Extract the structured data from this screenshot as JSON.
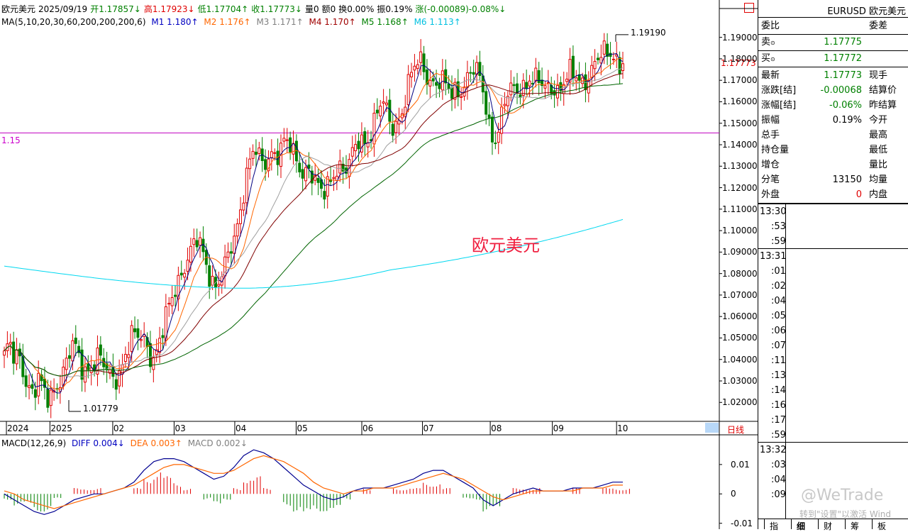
{
  "header": {
    "name": "欧元美元",
    "date": "2025/09/19",
    "open": "开1.17857↓",
    "high": "高1.17923↓",
    "low": "低1.17704↑",
    "close": "收1.17773↓",
    "volume": "量0",
    "amount": "额0",
    "turnover": "换0.00%",
    "amplitude": "振0.19%",
    "change": "涨(-0.00089)-0.08%↓"
  },
  "ma_legend": {
    "params": "MA(5,10,20,30,60,200,200,200,6)",
    "m1": "M1 1.180↑",
    "m2": "M2 1.176↑",
    "m3": "M3 1.171↑",
    "m4": "M4 1.170↑",
    "m5": "M5 1.168↑",
    "m6": "M6 1.113↑"
  },
  "macd_legend": {
    "params": "MACD(12,26,9)",
    "diff": "DIFF 0.004↓",
    "dea": "DEA 0.003↑",
    "macd": "MACD 0.002↓"
  },
  "chart_data": {
    "type": "candlestick",
    "y_ticks": [
      "1.19000",
      "1.18000",
      "1.17000",
      "1.16000",
      "1.15000",
      "1.14000",
      "1.13000",
      "1.12000",
      "1.11000",
      "1.10000",
      "1.09000",
      "1.08000",
      "1.07000",
      "1.06000",
      "1.05000",
      "1.04000",
      "1.03000",
      "1.02000"
    ],
    "x_ticks": [
      "2024",
      "2025",
      "02",
      "03",
      "04",
      "05",
      "06",
      "07",
      "08",
      "09",
      "10"
    ],
    "x_tick_pos": [
      0.005,
      0.066,
      0.154,
      0.24,
      0.325,
      0.411,
      0.503,
      0.588,
      0.683,
      0.77,
      0.86
    ],
    "ylim": [
      1.0125,
      1.1955
    ],
    "close_path": [
      1.042,
      1.045,
      1.038,
      1.041,
      1.035,
      1.03,
      1.025,
      1.03,
      1.022,
      1.02,
      1.026,
      1.032,
      1.036,
      1.04,
      1.045,
      1.04,
      1.035,
      1.038,
      1.04,
      1.042,
      1.036,
      1.032,
      1.03,
      1.034,
      1.04,
      1.045,
      1.05,
      1.047,
      1.05,
      1.048,
      1.043,
      1.045,
      1.05,
      1.058,
      1.065,
      1.075,
      1.082,
      1.088,
      1.09,
      1.094,
      1.09,
      1.085,
      1.08,
      1.077,
      1.079,
      1.082,
      1.088,
      1.095,
      1.11,
      1.125,
      1.135,
      1.138,
      1.13,
      1.128,
      1.135,
      1.14,
      1.138,
      1.142,
      1.138,
      1.132,
      1.13,
      1.128,
      1.133,
      1.125,
      1.118,
      1.114,
      1.12,
      1.128,
      1.133,
      1.13,
      1.128,
      1.133,
      1.14,
      1.142,
      1.145,
      1.15,
      1.155,
      1.158,
      1.152,
      1.148,
      1.152,
      1.158,
      1.165,
      1.172,
      1.175,
      1.178,
      1.174,
      1.172,
      1.17,
      1.168,
      1.165,
      1.162,
      1.166,
      1.168,
      1.171,
      1.174,
      1.172,
      1.168,
      1.16,
      1.148,
      1.145,
      1.15,
      1.158,
      1.163,
      1.165,
      1.168,
      1.17,
      1.172,
      1.168,
      1.167,
      1.165,
      1.168,
      1.17,
      1.166,
      1.168,
      1.171,
      1.17,
      1.172,
      1.17,
      1.175,
      1.176,
      1.178,
      1.18,
      1.182,
      1.185,
      1.18,
      1.1777
    ],
    "high_label": "1.19190",
    "low_label": "1.01779",
    "high_value": 1.1919,
    "low_value": 1.01779,
    "last_price_label": "1.17773",
    "last_price": 1.17773,
    "hline_label": "1.15",
    "hline_value": 1.1455,
    "watermark": "欧元美元",
    "period_label": "日线",
    "macd_ticks": [
      "0.01",
      "0",
      "-0.01"
    ],
    "macd_ylim": [
      -0.012,
      0.016
    ],
    "diff_values": [
      0.0,
      -0.002,
      -0.004,
      -0.006,
      -0.007,
      -0.006,
      -0.004,
      -0.002,
      -0.001,
      0.0,
      0.0,
      0.001,
      0.002,
      0.004,
      0.008,
      0.011,
      0.012,
      0.012,
      0.011,
      0.009,
      0.007,
      0.005,
      0.006,
      0.009,
      0.013,
      0.015,
      0.014,
      0.012,
      0.009,
      0.006,
      0.003,
      0.001,
      -0.001,
      -0.002,
      -0.001,
      0.001,
      0.002,
      0.002,
      0.002,
      0.003,
      0.004,
      0.005,
      0.007,
      0.008,
      0.008,
      0.006,
      0.004,
      0.002,
      -0.002,
      -0.004,
      -0.002,
      0.0,
      0.001,
      0.002,
      0.001,
      0.001,
      0.001,
      0.002,
      0.002,
      0.002,
      0.003,
      0.004,
      0.004
    ],
    "dea_values": [
      0.001,
      0.0,
      -0.002,
      -0.003,
      -0.004,
      -0.005,
      -0.004,
      -0.003,
      -0.002,
      -0.001,
      0.0,
      0.001,
      0.002,
      0.003,
      0.005,
      0.007,
      0.009,
      0.01,
      0.01,
      0.009,
      0.008,
      0.007,
      0.007,
      0.008,
      0.01,
      0.012,
      0.013,
      0.012,
      0.011,
      0.009,
      0.007,
      0.004,
      0.002,
      0.001,
      0.0,
      0.001,
      0.001,
      0.002,
      0.002,
      0.002,
      0.003,
      0.004,
      0.005,
      0.006,
      0.007,
      0.006,
      0.005,
      0.003,
      0.001,
      -0.001,
      -0.002,
      -0.001,
      0.0,
      0.001,
      0.001,
      0.001,
      0.001,
      0.001,
      0.002,
      0.002,
      0.002,
      0.003,
      0.003
    ]
  },
  "quote": {
    "title": "EURUSD 欧元美元",
    "wei_bi": "委比",
    "wei_cha": "委差",
    "sell_label": "卖",
    "sell_value": "1.17775",
    "buy_label": "买",
    "buy_value": "1.17772",
    "rows": [
      {
        "l": "最新",
        "v": "1.17773",
        "r": "现手",
        "color": "#008000"
      },
      {
        "l": "涨跌[结]",
        "v": "-0.00068",
        "r": "结算价",
        "color": "#008000"
      },
      {
        "l": "涨幅[结]",
        "v": "-0.06%",
        "r": "昨结算",
        "color": "#008000"
      },
      {
        "l": "振幅",
        "v": "0.19%",
        "r": "今开",
        "color": "#000000"
      },
      {
        "l": "总手",
        "v": "",
        "r": "最高",
        "color": "#000000"
      },
      {
        "l": "持仓量",
        "v": "",
        "r": "最低",
        "color": "#000000"
      },
      {
        "l": "增仓",
        "v": "",
        "r": "量比",
        "color": "#000000"
      },
      {
        "l": "分笔",
        "v": "13150",
        "r": "均量",
        "color": "#000000"
      },
      {
        "l": "外盘",
        "v": "0",
        "r": "内盘",
        "color": "#e00000"
      }
    ],
    "times": [
      "13:30",
      ":53",
      ":59",
      "13:31",
      ":01",
      ":02",
      ":04",
      ":05",
      ":06",
      ":07",
      ":11",
      ":13",
      ":14",
      ":16",
      ":17",
      ":59",
      "13:32",
      ":03",
      ":04",
      ":09"
    ],
    "tabs": [
      "指",
      "细",
      "财",
      "筹",
      "板"
    ],
    "watermark_text": "@WeTrade",
    "activate_text": "转到\"设置\"以激活 Wind"
  },
  "colors": {
    "up": "#e00000",
    "down": "#008000",
    "ma5": "#000080",
    "ma10": "#ff6600",
    "ma20": "#a0a0a0",
    "ma30": "#800000",
    "ma60": "#006400",
    "ma200": "#00d8f0",
    "macd_diff": "#000090",
    "macd_dea": "#ff6600"
  }
}
